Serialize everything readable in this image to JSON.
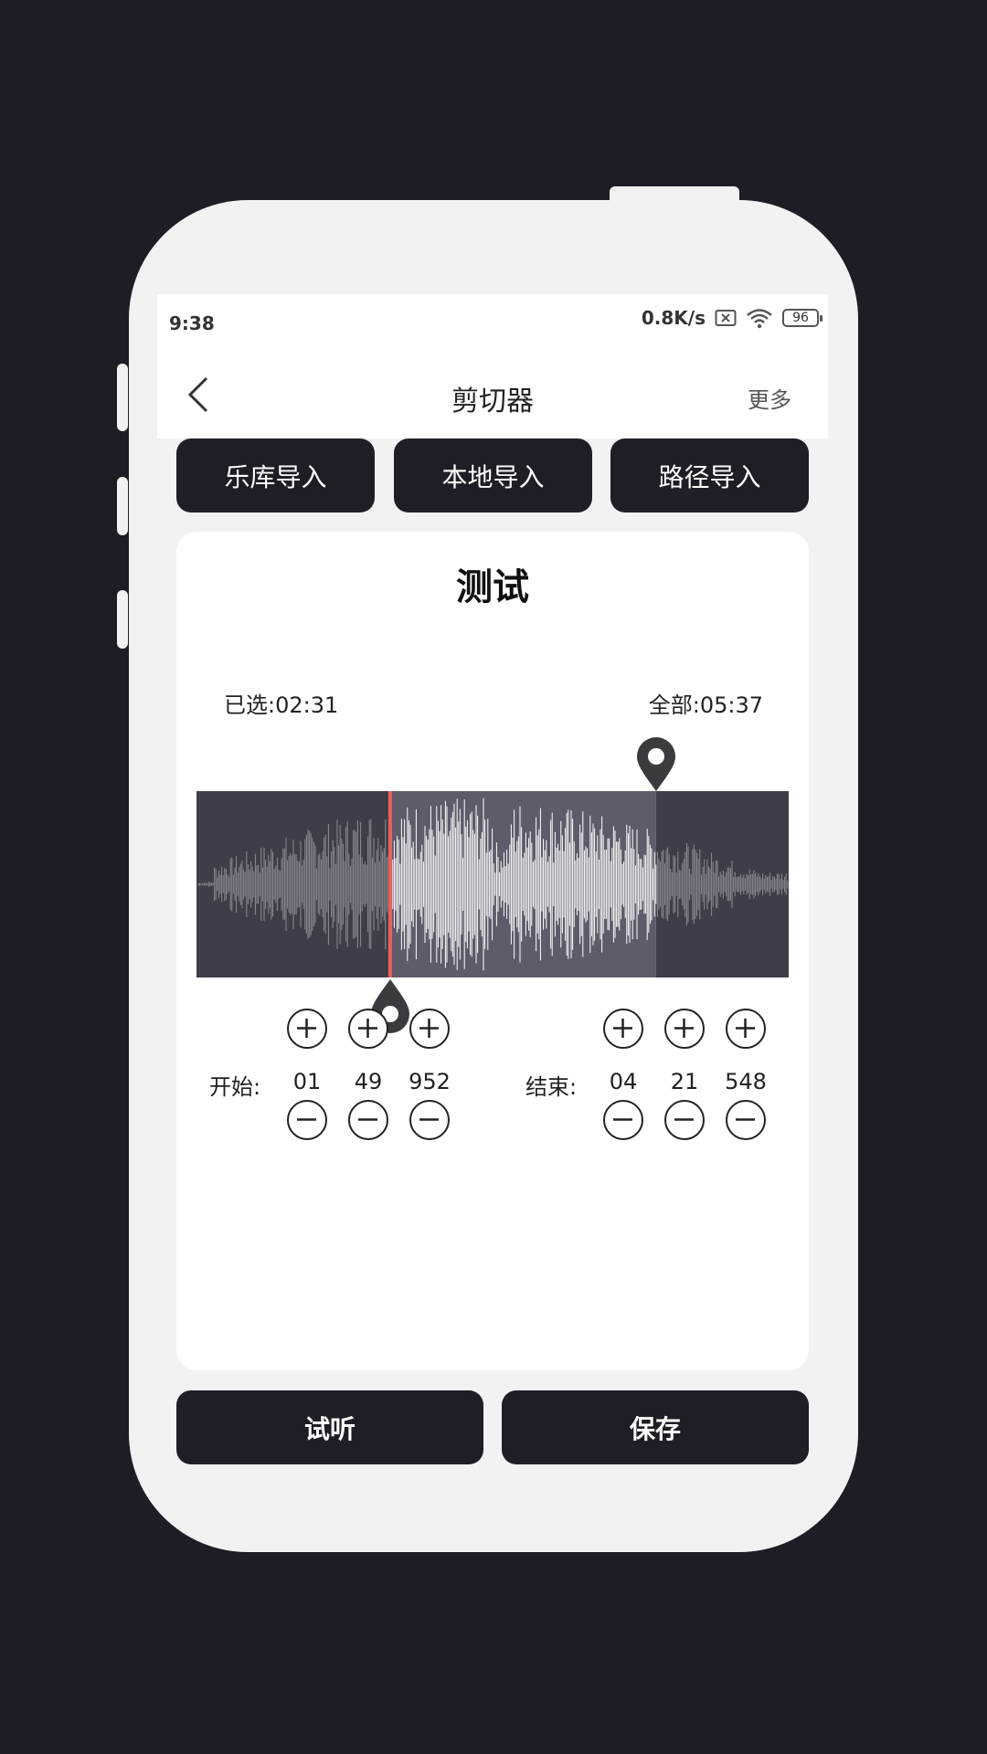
{
  "status": {
    "time": "9:38",
    "net_speed": "0.8K/s",
    "battery": "96"
  },
  "nav": {
    "title": "剪切器",
    "more": "更多"
  },
  "imports": [
    "乐库导入",
    "本地导入",
    "路径导入"
  ],
  "card": {
    "title": "测试",
    "selected": "已选:02:31",
    "total": "全部:05:37"
  },
  "waveform": {
    "selection_start_fraction": 0.327,
    "selection_end_fraction": 0.776,
    "playhead_fraction": 0.327
  },
  "start": {
    "label": "开始:",
    "values": [
      "01",
      "49",
      "952"
    ]
  },
  "end": {
    "label": "结束:",
    "values": [
      "04",
      "21",
      "548"
    ]
  },
  "actions": {
    "preview": "试听",
    "save": "保存"
  },
  "colors": {
    "dark": "#1e1e26",
    "playhead": "#e9605a",
    "wave_selected": "#ffffff",
    "wave_unselected": "#8c8c92"
  }
}
